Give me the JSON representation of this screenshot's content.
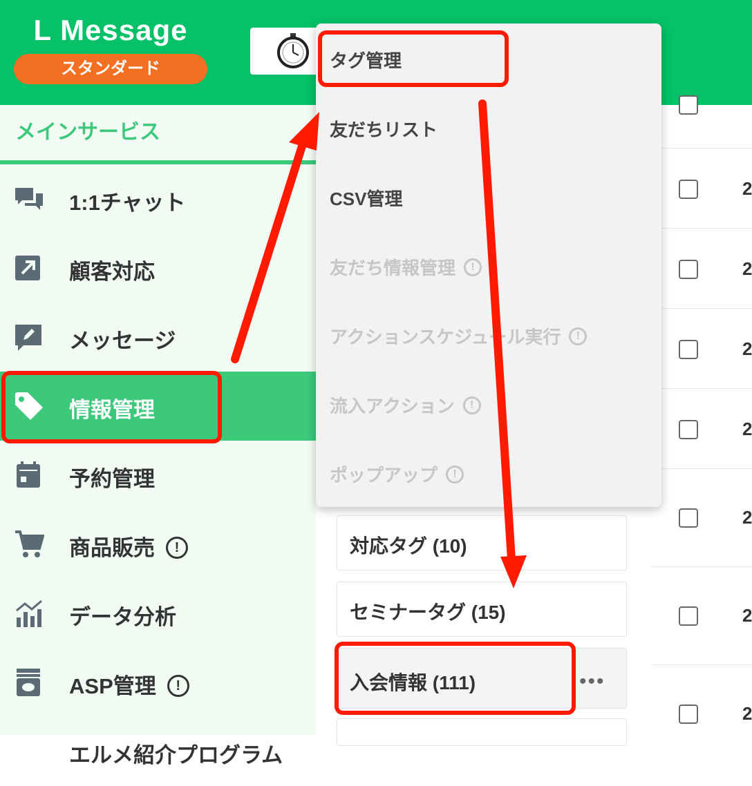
{
  "header": {
    "logo": "L Message",
    "plan_badge": "スタンダード"
  },
  "sidebar": {
    "heading": "メインサービス",
    "items": [
      {
        "label": "1:1チャット",
        "icon": "chat-icon"
      },
      {
        "label": "顧客対応",
        "icon": "arrow-up-right-icon"
      },
      {
        "label": "メッセージ",
        "icon": "message-edit-icon"
      },
      {
        "label": "情報管理",
        "icon": "tag-icon",
        "active": true
      },
      {
        "label": "予約管理",
        "icon": "calendar-icon"
      },
      {
        "label": "商品販売",
        "icon": "cart-icon",
        "warning": "!"
      },
      {
        "label": "データ分析",
        "icon": "chart-icon"
      },
      {
        "label": "ASP管理",
        "icon": "archive-icon",
        "warning": "!"
      },
      {
        "label": "エルメ紹介プログラム"
      }
    ]
  },
  "dropdown": {
    "items": [
      {
        "label": "タグ管理",
        "enabled": true
      },
      {
        "label": "友だちリスト",
        "enabled": true
      },
      {
        "label": "CSV管理",
        "enabled": true
      },
      {
        "label": "友だち情報管理",
        "enabled": false,
        "warning": "!"
      },
      {
        "label": "アクションスケジュール実行",
        "enabled": false,
        "warning": "!"
      },
      {
        "label": "流入アクション",
        "enabled": false,
        "warning": "!"
      },
      {
        "label": "ポップアップ",
        "enabled": false,
        "warning": "!"
      }
    ]
  },
  "tag_folders": [
    {
      "label": "対応タグ (10)"
    },
    {
      "label": "セミナータグ (15)"
    },
    {
      "label": "入会情報 (111)",
      "selected": true,
      "more": "•••"
    }
  ],
  "table": {
    "row_digit": "2"
  },
  "colors": {
    "brand_green": "#06c167",
    "sidebar_active": "#3cc97c",
    "badge_orange": "#f36f21",
    "annotation_red": "#ff1a00"
  }
}
